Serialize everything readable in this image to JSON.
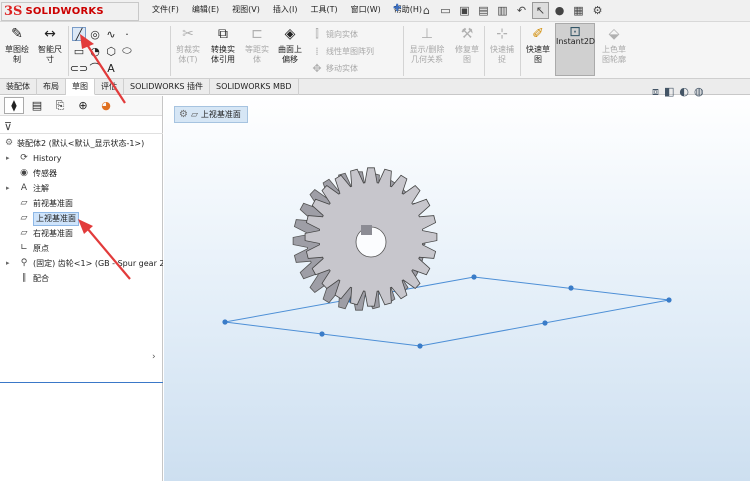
{
  "app": {
    "logo_ds": "3S",
    "logo_text": "SOLIDWORKS"
  },
  "menu": [
    "文件(F)",
    "编辑(E)",
    "视图(V)",
    "插入(I)",
    "工具(T)",
    "窗口(W)",
    "帮助(H)"
  ],
  "cmd": {
    "sketch": "草图绘\n制",
    "smart_dim": "智能尺\n寸",
    "trim": "剪裁实\n体(T)",
    "convert": "转换实\n体引用",
    "offset_entities": "等距实\n体",
    "surface_offset": "曲面上\n偏移",
    "mirror": "镜向实体",
    "linear_pattern": "线性草图阵列",
    "move": "移动实体",
    "display_relations": "显示/删除\n几何关系",
    "repair": "修复草\n图",
    "quick_snap": "快速捕\n捉",
    "rapid_sketch": "快速草\n图",
    "instant2d": "Instant2D",
    "shaded_contours": "上色草\n图轮廓"
  },
  "tabs": [
    "装配体",
    "布局",
    "草图",
    "评估",
    "SOLIDWORKS 插件",
    "SOLIDWORKS MBD"
  ],
  "active_tab": "草图",
  "tree": {
    "root": "装配体2 (默认<默认_显示状态-1>)",
    "items": [
      {
        "label": "History",
        "expandable": true,
        "icon": "history-icon"
      },
      {
        "label": "传感器",
        "expandable": false,
        "icon": "sensor-icon"
      },
      {
        "label": "注解",
        "expandable": true,
        "icon": "annotation-icon"
      },
      {
        "label": "前视基准面",
        "expandable": false,
        "icon": "plane-icon"
      },
      {
        "label": "上视基准面",
        "expandable": false,
        "icon": "plane-icon",
        "selected": true
      },
      {
        "label": "右视基准面",
        "expandable": false,
        "icon": "plane-icon"
      },
      {
        "label": "原点",
        "expandable": false,
        "icon": "origin-icon"
      },
      {
        "label": "(固定) 齿轮<1> (GB - Spur gear 2",
        "expandable": true,
        "icon": "part-icon"
      },
      {
        "label": "配合",
        "expandable": false,
        "icon": "mate-icon"
      }
    ]
  },
  "viewport": {
    "selected_plane": "上视基准面"
  }
}
